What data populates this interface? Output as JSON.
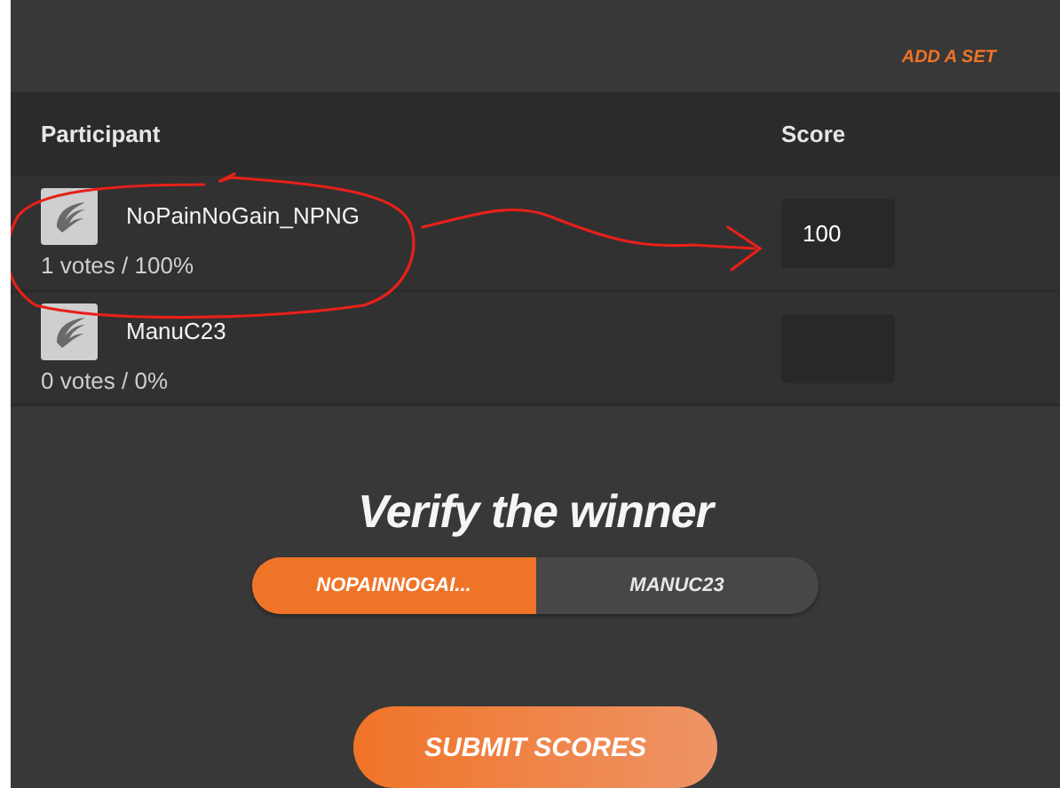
{
  "header_action": "ADD A SET",
  "table": {
    "columns": [
      "Participant",
      "Score"
    ],
    "rows": [
      {
        "name": "NoPainNoGain_NPNG",
        "votes": "1 votes / 100%",
        "score": "100"
      },
      {
        "name": "ManuC23",
        "votes": "0 votes / 0%"
      }
    ]
  },
  "verify": {
    "title": "Verify the winner",
    "options": [
      {
        "label": "NOPAINNOGAI...",
        "selected": true
      },
      {
        "label": "MANUC23",
        "selected": false
      }
    ]
  },
  "submit": "SUBMIT SCORES"
}
